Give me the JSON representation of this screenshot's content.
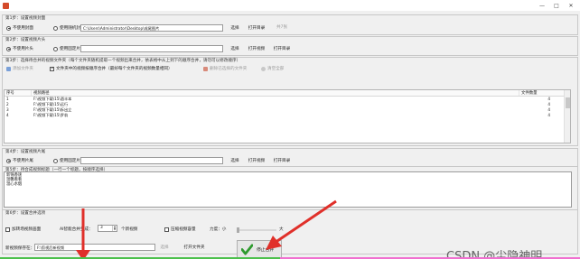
{
  "window": {
    "title": "",
    "btn_min": "—",
    "btn_max": "□",
    "btn_close": "✕"
  },
  "step1": {
    "title": "第1步：设置视频封面",
    "opt_none": "不使用封面",
    "opt_random": "使用随机封面",
    "path": "C:\\Users\\Administrator\\Desktop\\成尾图片",
    "btn_select": "选择",
    "btn_open": "打开目录",
    "count": "共7张"
  },
  "step2": {
    "title": "第2步：设置视频片头",
    "opt_none": "不使用片头",
    "opt_fixed": "使用固定片头",
    "path": "",
    "btn_select": "选择",
    "btn_open_video": "打开视频",
    "btn_open_dir": "打开目录"
  },
  "step3": {
    "title": "第3步：选择待合并的视频文件夹（每个文件夹随机提取一个视频出来合并，依表格中从上到下的顺序合并，请勿可以修改顺序）",
    "tb_add": "添加文件夹",
    "chk_label": "文件夹中的视频按顺序合并（最好每个文件夹的视频数量相同）",
    "tb_remove": "删除已选择的文件夹",
    "tb_clear": "清空全部",
    "columns": [
      "序号",
      "视频路径",
      "文件数量"
    ],
    "rows": [
      {
        "idx": "1",
        "path": "F:\\视频下载\\15\\酒丰本",
        "count": "4"
      },
      {
        "idx": "2",
        "path": "F:\\视频下载\\15\\远行",
        "count": "4"
      },
      {
        "idx": "3",
        "path": "F:\\视频下载\\15\\拆出立",
        "count": "4"
      },
      {
        "idx": "4",
        "path": "F:\\视频下载\\15\\罗翁",
        "count": "4"
      }
    ]
  },
  "step4": {
    "title": "第4步：设置视频片尾",
    "opt_none": "不使用片尾",
    "opt_fixed": "使用固定片尾",
    "path": "",
    "btn_select": "选择",
    "btn_open_video": "打开视频",
    "btn_open_dir": "打开目录"
  },
  "step5": {
    "title": "第5步：待合成视频标题（一行一个标题，按顺序选择）",
    "lines": [
      "新锦香速",
      "温馨看看",
      "温心水烟"
    ]
  },
  "step6": {
    "title": "第6步：设置合并选项",
    "chk_transition": "加转场视频画面",
    "count_label": "AI智能合并生成：",
    "count_value": "3",
    "count_unit": "个新视频",
    "chk_compress": "压缩视频容量",
    "power_label": "力度：小",
    "power_max": "大",
    "power_level": 0,
    "save_label": "新视频保存在：",
    "save_path": "F:\\剪视后新视频",
    "btn_select": "选择",
    "btn_open": "打开文件夹",
    "btn_stop": "停止合并"
  },
  "watermark": "CSDN @尘隐神明",
  "colors": {
    "accent_red": "#e0302a",
    "check_green": "#2e9a2e",
    "status_green": "#4cc04c",
    "status_pink": "#f070d0"
  }
}
